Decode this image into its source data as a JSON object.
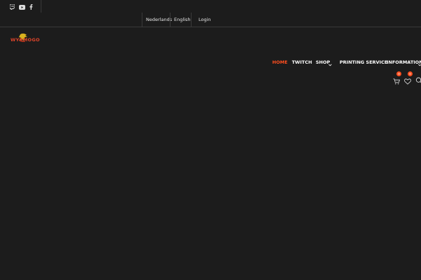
{
  "topbar": {
    "social": [
      {
        "icon": "twitch-icon"
      },
      {
        "icon": "youtube-icon"
      },
      {
        "icon": "facebook-icon"
      }
    ],
    "languages": [
      "Nederlands",
      "English"
    ],
    "login_label": "Login"
  },
  "logo": {
    "text": "WYRMOGO"
  },
  "nav": {
    "items": [
      {
        "label": "HOME",
        "active": true
      },
      {
        "label": "TWITCH",
        "active": false
      },
      {
        "label": "SHOP",
        "active": false,
        "dropdown": true
      },
      {
        "label": "PRINTING SERVICE",
        "active": false
      },
      {
        "label": "INFORMATION",
        "active": false,
        "dropdown": true
      }
    ]
  },
  "icons": {
    "cart_count": "0",
    "wishlist_count": "0"
  },
  "colors": {
    "background": "#1c1c1c",
    "accent": "#ff4e1f",
    "divider": "#3a3a3a"
  }
}
